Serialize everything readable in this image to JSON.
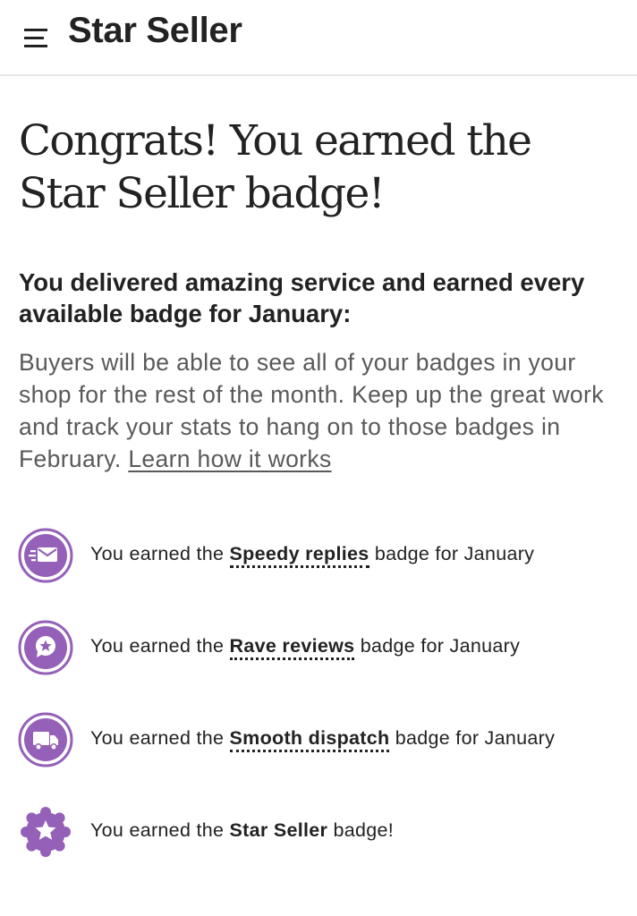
{
  "header": {
    "title": "Star Seller",
    "menu_icon": "hamburger-menu-icon"
  },
  "main": {
    "heading": "Congrats! You earned the Star Seller badge!",
    "subheading": "You delivered amazing service and earned every available badge for January:",
    "body": "Buyers will be able to see all of your badges in your shop for the rest of the month. Keep up the great work and track your stats to hang on to those badges in February.",
    "learn_link": "Learn how it works"
  },
  "badges": [
    {
      "icon": "envelope-icon",
      "prefix": "You earned the",
      "name": "Speedy replies",
      "suffix": "badge for January"
    },
    {
      "icon": "star-speech-bubble-icon",
      "prefix": "You earned the",
      "name": "Rave reviews",
      "suffix": "badge for January"
    },
    {
      "icon": "delivery-truck-icon",
      "prefix": "You earned the",
      "name": "Smooth dispatch",
      "suffix": "badge for January"
    },
    {
      "icon": "star-seller-seal-icon",
      "prefix": "You earned the",
      "name": "Star Seller",
      "suffix": "badge!"
    }
  ],
  "colors": {
    "badge_purple": "#9560B8",
    "badge_light": "#EDE3F3",
    "text": "#222222",
    "muted": "#595959"
  }
}
